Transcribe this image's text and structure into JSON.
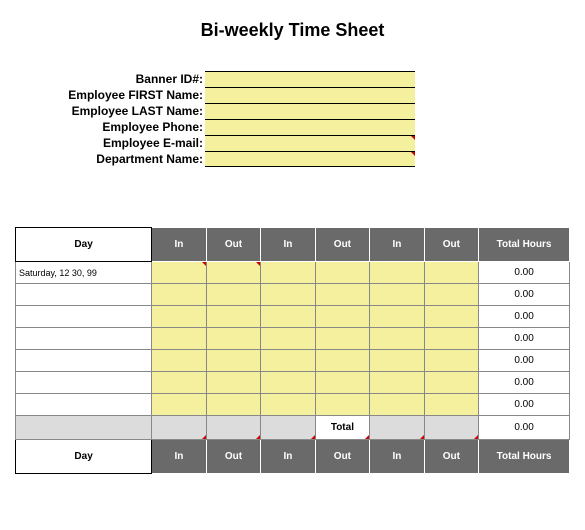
{
  "title": "Bi-weekly Time Sheet",
  "info": {
    "labels": {
      "banner_id": "Banner ID#:",
      "first_name": "Employee FIRST Name:",
      "last_name": "Employee LAST Name:",
      "phone": "Employee Phone:",
      "email": "Employee E-mail:",
      "department": "Department Name:"
    },
    "values": {
      "banner_id": "",
      "first_name": "",
      "last_name": "",
      "phone": "",
      "email": "",
      "department": ""
    }
  },
  "headers": {
    "day": "Day",
    "in": "In",
    "out": "Out",
    "total_hours": "Total Hours",
    "total": "Total"
  },
  "rows": [
    {
      "day": "Saturday, 12 30, 99",
      "total": "0.00"
    },
    {
      "day": "",
      "total": "0.00"
    },
    {
      "day": "",
      "total": "0.00"
    },
    {
      "day": "",
      "total": "0.00"
    },
    {
      "day": "",
      "total": "0.00"
    },
    {
      "day": "",
      "total": "0.00"
    },
    {
      "day": "",
      "total": "0.00"
    }
  ],
  "grand_total": "0.00"
}
